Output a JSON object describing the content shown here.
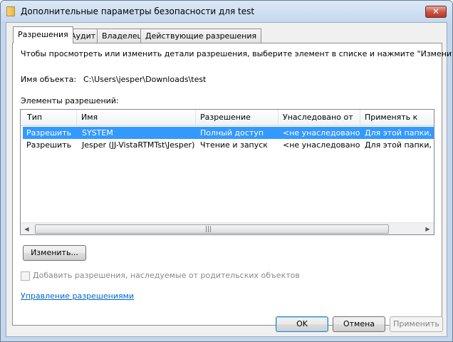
{
  "window": {
    "title": "Дополнительные параметры безопасности для test",
    "close_label": "✕"
  },
  "tabs": [
    {
      "label": "Разрешения",
      "active": true
    },
    {
      "label": "Аудит",
      "active": false
    },
    {
      "label": "Владелец",
      "active": false
    },
    {
      "label": "Действующие разрешения",
      "active": false
    }
  ],
  "permissions": {
    "instruction": "Чтобы просмотреть или изменить детали разрешения, выберите элемент в списке и нажмите \"Изменить\".",
    "object_name_label": "Имя объекта:",
    "object_name_value": "C:\\Users\\jesper\\Downloads\\test",
    "entries_label": "Элементы разрешений:",
    "columns": [
      "Тип",
      "Имя",
      "Разрешение",
      "Унаследовано от",
      "Применять к"
    ],
    "rows": [
      {
        "type": "Разрешить",
        "name": "SYSTEM",
        "permission": "Полный доступ",
        "inherited_from": "<не унаследовано>",
        "apply_to": "Для этой папки, ее",
        "selected": true
      },
      {
        "type": "Разрешить",
        "name": "Jesper (JJ-VistaRTMTst\\Jesper)",
        "permission": "Чтение и запуск",
        "inherited_from": "<не унаследовано>",
        "apply_to": "Для этой папки, ее",
        "selected": false
      }
    ],
    "scroll": {
      "left_arrow": "◀",
      "right_arrow": "▶",
      "grip": "|||"
    },
    "edit_button": "Изменить...",
    "inherit_checkbox_label": "Добавить разрешения, наследуемые от родительских объектов",
    "inherit_checked": false,
    "manage_link": "Управление разрешениями"
  },
  "footer": {
    "ok_label": "OK",
    "cancel_label": "Отмена",
    "apply_label": "Применить"
  },
  "colors": {
    "selection": "#3399ff",
    "link": "#0066cc",
    "frame": "#c3d6ec"
  }
}
